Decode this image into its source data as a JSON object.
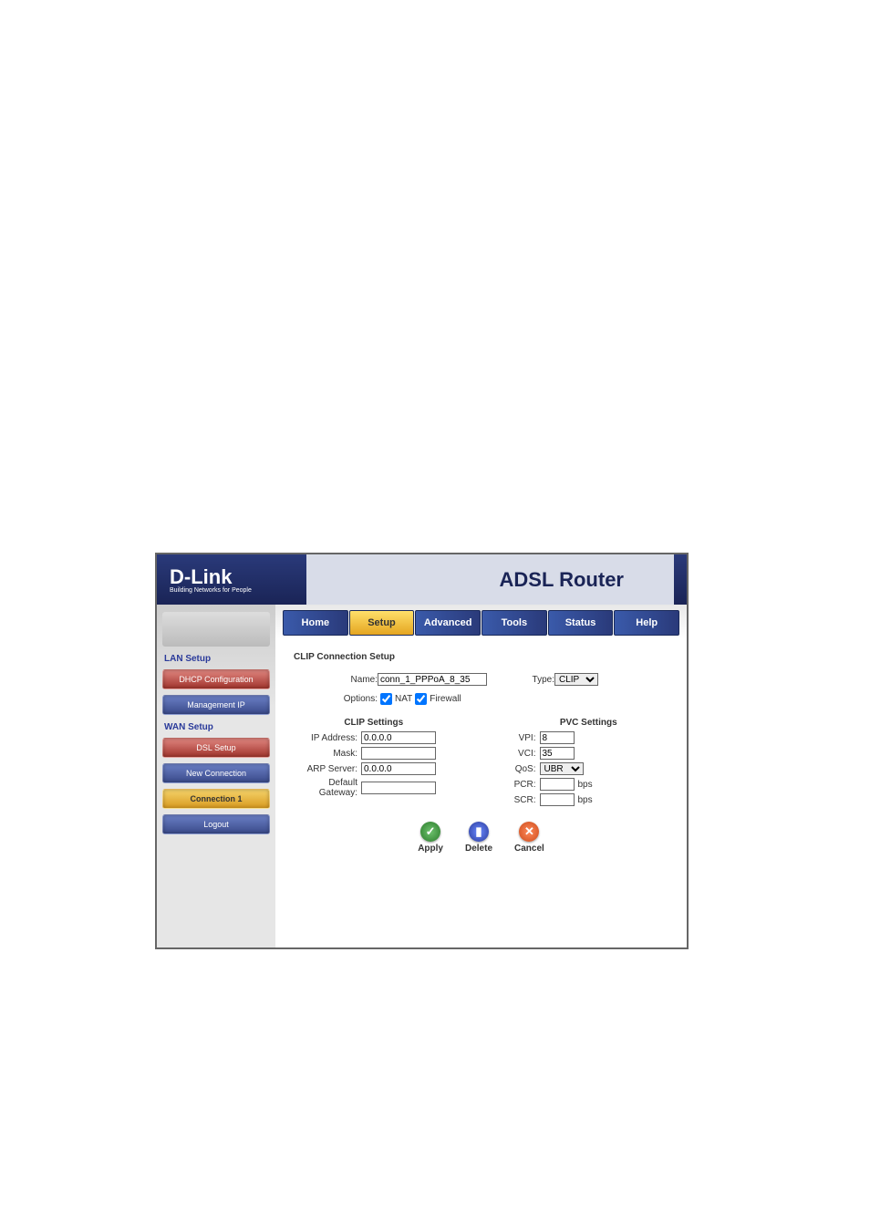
{
  "logo": {
    "brand": "D-Link",
    "tagline": "Building Networks for People"
  },
  "router_title": "ADSL Router",
  "tabs": {
    "home": "Home",
    "setup": "Setup",
    "advanced": "Advanced",
    "tools": "Tools",
    "status": "Status",
    "help": "Help"
  },
  "sidebar": {
    "lan_heading": "LAN Setup",
    "dhcp_btn": "DHCP Configuration",
    "mgmt_btn": "Management IP",
    "wan_heading": "WAN Setup",
    "dsl_btn": "DSL Setup",
    "new_conn_btn": "New Connection",
    "conn1_btn": "Connection 1",
    "logout_btn": "Logout"
  },
  "content": {
    "title": "CLIP Connection Setup",
    "name_label": "Name:",
    "name_value": "conn_1_PPPoA_8_35",
    "type_label": "Type:",
    "type_value": "CLIP",
    "options_label": "Options:",
    "nat_label": "NAT",
    "firewall_label": "Firewall",
    "clip": {
      "heading": "CLIP Settings",
      "ip_label": "IP Address:",
      "ip_value": "0.0.0.0",
      "mask_label": "Mask:",
      "mask_value": "",
      "arp_label": "ARP Server:",
      "arp_value": "0.0.0.0",
      "gw_label": "Default Gateway:",
      "gw_value": ""
    },
    "pvc": {
      "heading": "PVC Settings",
      "vpi_label": "VPI:",
      "vpi_value": "8",
      "vci_label": "VCI:",
      "vci_value": "35",
      "qos_label": "QoS:",
      "qos_value": "UBR",
      "pcr_label": "PCR:",
      "pcr_value": "",
      "scr_label": "SCR:",
      "scr_value": "",
      "unit": "bps"
    },
    "actions": {
      "apply": "Apply",
      "delete": "Delete",
      "cancel": "Cancel"
    }
  }
}
